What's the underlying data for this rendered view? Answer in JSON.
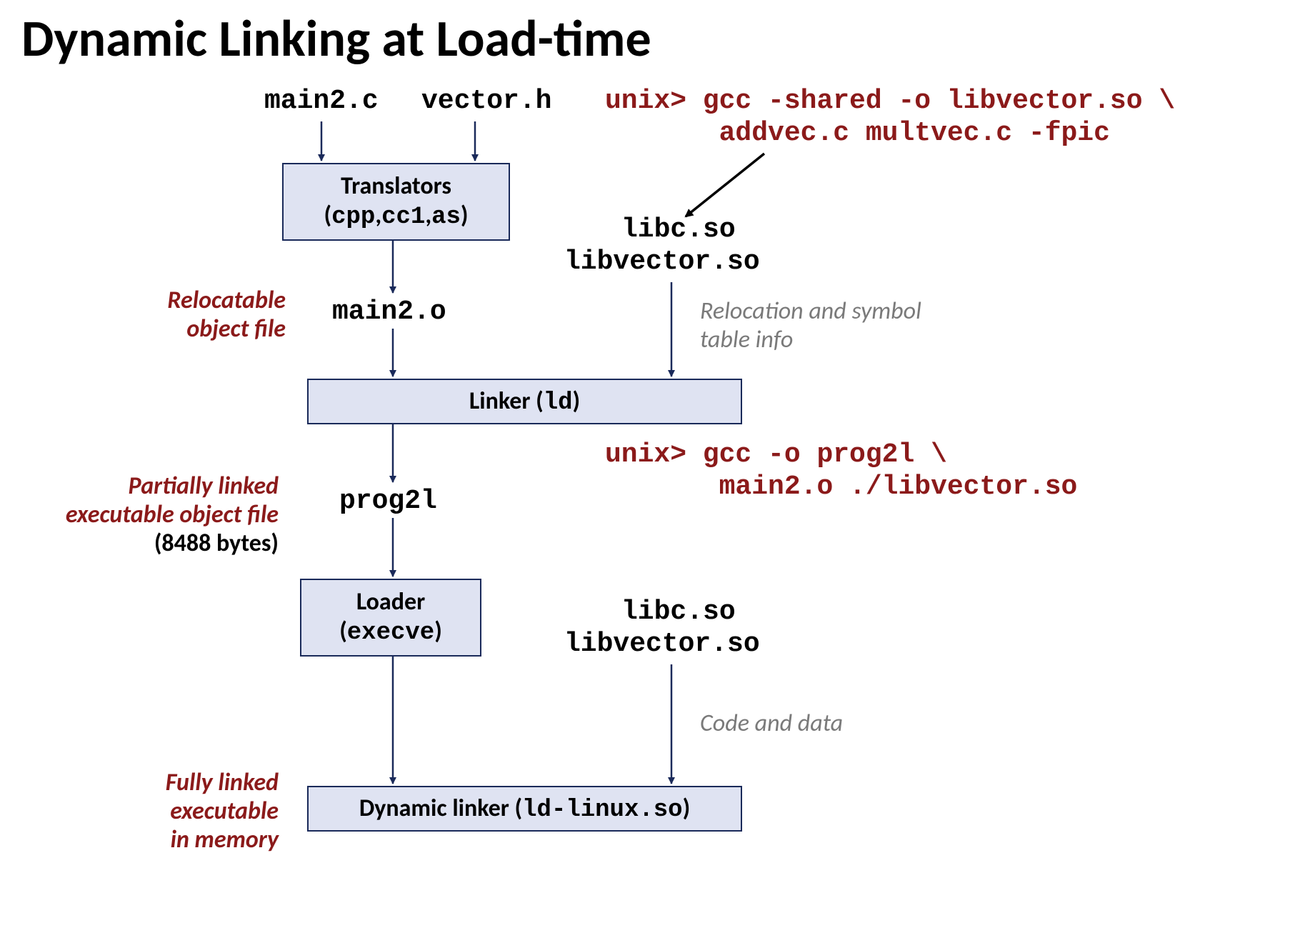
{
  "title": "Dynamic Linking at Load-time",
  "source_files": {
    "main_c": "main2.c",
    "vector_h": "vector.h"
  },
  "boxes": {
    "translators": {
      "line1": "Translators",
      "line2": "(cpp, cc1, as)"
    },
    "linker": "Linker (ld)",
    "loader": {
      "line1": "Loader",
      "line2": "(execve)"
    },
    "dynlinker": "Dynamic linker (ld-linux.so)"
  },
  "intermediates": {
    "main_o": "main2.o",
    "prog2l": "prog2l"
  },
  "libs": {
    "libc_so_1": "libc.so",
    "libvector_so_1": "libvector.so",
    "libc_so_2": "libc.so",
    "libvector_so_2": "libvector.so"
  },
  "commands": {
    "gcc_shared_l1": "unix> gcc -shared -o libvector.so \\",
    "gcc_shared_l2": "       addvec.c multvec.c -fpic",
    "gcc_link_l1": "unix> gcc -o prog2l \\",
    "gcc_link_l2": "       main2.o ./libvector.so"
  },
  "annotations": {
    "relocatable_l1": "Relocatable",
    "relocatable_l2": "object file",
    "reloc_info_l1": "Relocation and symbol",
    "reloc_info_l2": "table info",
    "partially_l1": "Partially linked",
    "partially_l2": "executable object file",
    "partially_size": "(8488 bytes)",
    "code_data": "Code and data",
    "fully_l1": "Fully linked",
    "fully_l2": "executable",
    "fully_l3": "in memory"
  }
}
